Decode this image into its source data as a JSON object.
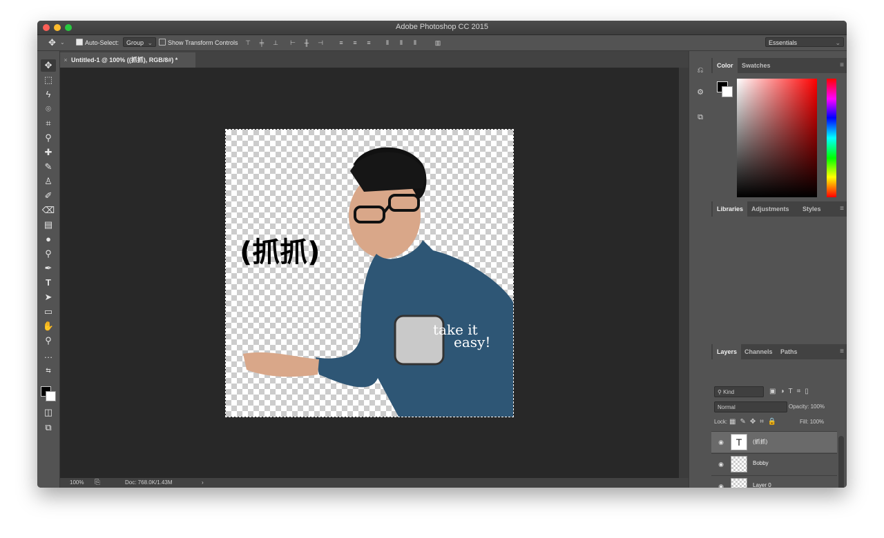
{
  "window": {
    "title": "Adobe Photoshop CC 2015"
  },
  "options_bar": {
    "move_tool_icon": "move-icon",
    "auto_select_label": "Auto-Select:",
    "auto_select_checked": true,
    "auto_select_value": "Group",
    "transform_label": "Show Transform Controls",
    "transform_checked": false,
    "workspace": "Essentials"
  },
  "toolbar": {
    "tools": [
      "move",
      "marquee",
      "lasso",
      "quick-select",
      "crop",
      "eyedropper",
      "healing",
      "brush",
      "stamp",
      "history-brush",
      "eraser",
      "gradient",
      "blur",
      "dodge",
      "pen",
      "type",
      "path-select",
      "shape",
      "hand",
      "zoom",
      "more"
    ]
  },
  "document": {
    "tab_title": "Untitled-1 @ 100% ((抓抓), RGB/8#) *",
    "canvas_text": "(抓抓)",
    "zoom": "100%",
    "doc_info": "Doc: 768.0K/1.43M"
  },
  "color_panel": {
    "tabs": [
      "Color",
      "Swatches"
    ],
    "active_tab": "Color",
    "foreground": "#000000",
    "background": "#ffffff"
  },
  "libraries_panel": {
    "tabs": [
      "Libraries",
      "Adjustments",
      "Styles"
    ],
    "active_tab": "Libraries"
  },
  "layers_panel": {
    "tabs": [
      "Layers",
      "Channels",
      "Paths"
    ],
    "active_tab": "Layers",
    "filter": "Kind",
    "blend_mode": "Normal",
    "opacity_label": "Opacity:",
    "opacity": "100%",
    "lock_label": "Lock:",
    "fill_label": "Fill:",
    "fill": "100%",
    "layers": [
      {
        "name": "(抓抓)",
        "type": "text",
        "visible": true,
        "selected": true
      },
      {
        "name": "Bobby",
        "type": "smart-object",
        "visible": true,
        "selected": false
      },
      {
        "name": "Layer 0",
        "type": "pixel",
        "visible": true,
        "selected": false
      }
    ]
  }
}
